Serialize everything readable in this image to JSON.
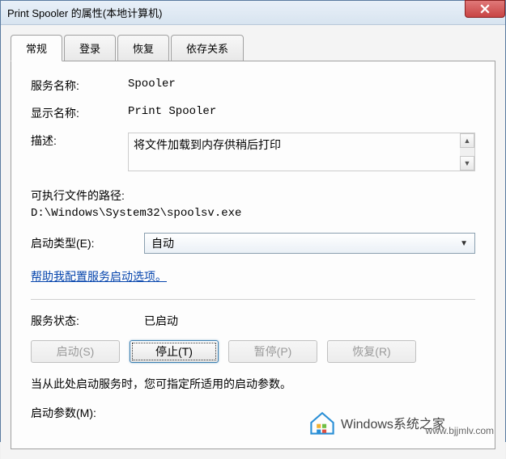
{
  "window": {
    "title": "Print Spooler 的属性(本地计算机)"
  },
  "tabs": {
    "general": "常规",
    "logon": "登录",
    "recovery": "恢复",
    "dependencies": "依存关系"
  },
  "fields": {
    "serviceNameLabel": "服务名称:",
    "serviceName": "Spooler",
    "displayNameLabel": "显示名称:",
    "displayName": "Print Spooler",
    "descriptionLabel": "描述:",
    "description": "将文件加载到内存供稍后打印",
    "executablePathLabel": "可执行文件的路径:",
    "executablePath": "D:\\Windows\\System32\\spoolsv.exe",
    "startupTypeLabel": "启动类型(E):",
    "startupType": "自动",
    "helpLink": "帮助我配置服务启动选项。",
    "serviceStatusLabel": "服务状态:",
    "serviceStatus": "已启动",
    "hint": "当从此处启动服务时，您可指定所适用的启动参数。",
    "startParamsLabel": "启动参数(M):"
  },
  "buttons": {
    "start": "启动(S)",
    "stop": "停止(T)",
    "pause": "暂停(P)",
    "resume": "恢复(R)"
  },
  "watermark": {
    "brand": "Windows系统之家",
    "url": "www.bjjmlv.com"
  }
}
